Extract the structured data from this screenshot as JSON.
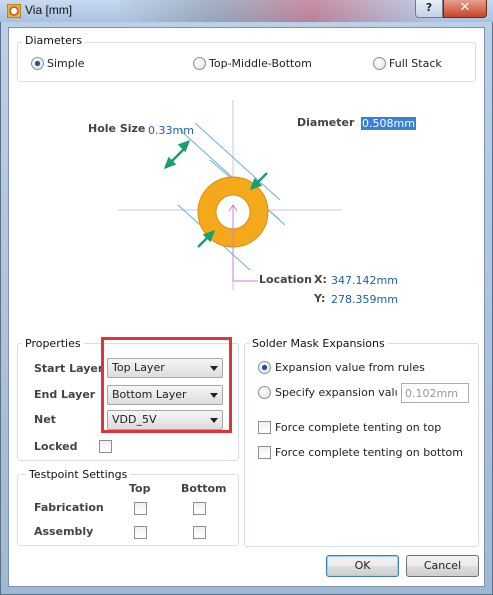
{
  "window": {
    "title": "Via [mm]",
    "help_label": "?",
    "close_label": "✕"
  },
  "diameters": {
    "legend": "Diameters",
    "options": [
      "Simple",
      "Top-Middle-Bottom",
      "Full Stack"
    ],
    "selected": "Simple"
  },
  "diagram": {
    "hole_size_label": "Hole Size",
    "hole_size_value": "0.33mm",
    "diameter_label": "Diameter",
    "diameter_value": "0.508mm",
    "location_label": "Location",
    "x_label": "X:",
    "x_value": "347.142mm",
    "y_label": "Y:",
    "y_value": "278.359mm",
    "ring_color": "#f3a91b",
    "arrow_color": "#1a9e6e"
  },
  "properties": {
    "legend": "Properties",
    "start_layer_label": "Start Layer",
    "start_layer_value": "Top Layer",
    "end_layer_label": "End Layer",
    "end_layer_value": "Bottom Layer",
    "net_label": "Net",
    "net_value": "VDD_5V",
    "locked_label": "Locked",
    "locked": false
  },
  "testpoint": {
    "legend": "Testpoint Settings",
    "col_top": "Top",
    "col_bottom": "Bottom",
    "rows": [
      "Fabrication",
      "Assembly"
    ]
  },
  "solder_mask": {
    "legend": "Solder Mask Expansions",
    "option_rules": "Expansion value from rules",
    "option_specify": "Specify expansion value",
    "specify_placeholder": "0.102mm",
    "selected": "Expansion value from rules",
    "tent_top": "Force complete tenting on top",
    "tent_bottom": "Force complete tenting on bottom"
  },
  "buttons": {
    "ok": "OK",
    "cancel": "Cancel"
  },
  "highlight_color": "#e0343a"
}
